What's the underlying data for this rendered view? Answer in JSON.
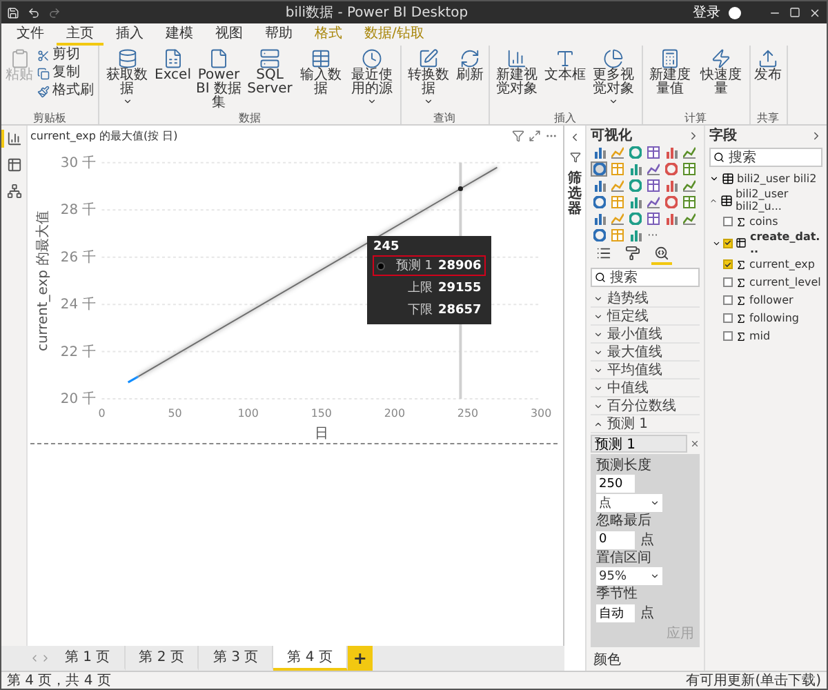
{
  "window": {
    "title": "bili数据 - Power BI Desktop",
    "sign_in": "登录"
  },
  "ribbon_tabs": [
    {
      "label": "文件",
      "selected": false,
      "kind": "normal"
    },
    {
      "label": "主页",
      "selected": true,
      "kind": "normal"
    },
    {
      "label": "插入",
      "selected": false,
      "kind": "normal"
    },
    {
      "label": "建模",
      "selected": false,
      "kind": "normal"
    },
    {
      "label": "视图",
      "selected": false,
      "kind": "normal"
    },
    {
      "label": "帮助",
      "selected": false,
      "kind": "normal"
    },
    {
      "label": "格式",
      "selected": false,
      "kind": "contextual"
    },
    {
      "label": "数据/钻取",
      "selected": false,
      "kind": "contextual"
    }
  ],
  "ribbon_groups": [
    {
      "label": "剪贴板",
      "buttons": [
        {
          "label": "粘贴",
          "kind": "large",
          "disabled": true,
          "dropdown": false
        },
        {
          "label": "剪切",
          "kind": "small",
          "disabled": false,
          "dropdown": false
        },
        {
          "label": "复制",
          "kind": "small",
          "disabled": false,
          "dropdown": false
        },
        {
          "label": "格式刷",
          "kind": "small",
          "disabled": false,
          "dropdown": false
        }
      ]
    },
    {
      "label": "数据",
      "buttons": [
        {
          "label": "获取数据",
          "kind": "large",
          "disabled": false,
          "dropdown": true
        },
        {
          "label": "Excel",
          "kind": "large",
          "disabled": false,
          "dropdown": false
        },
        {
          "label": "Power BI 数据集",
          "kind": "large",
          "disabled": false,
          "dropdown": false
        },
        {
          "label": "SQL Server",
          "kind": "large",
          "disabled": false,
          "dropdown": false
        },
        {
          "label": "输入数据",
          "kind": "large",
          "disabled": false,
          "dropdown": false
        },
        {
          "label": "最近使用的源",
          "kind": "large",
          "disabled": false,
          "dropdown": true
        }
      ]
    },
    {
      "label": "查询",
      "buttons": [
        {
          "label": "转换数据",
          "kind": "large",
          "disabled": false,
          "dropdown": true
        },
        {
          "label": "刷新",
          "kind": "large",
          "disabled": false,
          "dropdown": false
        }
      ]
    },
    {
      "label": "插入",
      "buttons": [
        {
          "label": "新建视觉对象",
          "kind": "large",
          "disabled": false,
          "dropdown": false
        },
        {
          "label": "文本框",
          "kind": "large",
          "disabled": false,
          "dropdown": false
        },
        {
          "label": "更多视觉对象",
          "kind": "large",
          "disabled": false,
          "dropdown": true
        }
      ]
    },
    {
      "label": "计算",
      "buttons": [
        {
          "label": "新建度量值",
          "kind": "large",
          "disabled": false,
          "dropdown": false
        },
        {
          "label": "快速度量",
          "kind": "large",
          "disabled": false,
          "dropdown": false
        }
      ]
    },
    {
      "label": "共享",
      "buttons": [
        {
          "label": "发布",
          "kind": "large",
          "disabled": false,
          "dropdown": false
        }
      ]
    }
  ],
  "views": [
    {
      "selected": true
    },
    {
      "selected": false
    },
    {
      "selected": false
    }
  ],
  "visual": {
    "title": "current_exp 的最大值(按 日)",
    "chart_data": {
      "type": "line",
      "xlabel": "日",
      "ylabel": "current_exp 的最大值",
      "x": [
        18,
        25,
        245,
        270
      ],
      "series": [
        {
          "color": "#118dff",
          "values": [
            20.7,
            20.95,
            null,
            null
          ]
        },
        {
          "color": "#6e6e6e",
          "values": [
            null,
            20.95,
            28.9,
            29.8
          ]
        }
      ],
      "xlim": [
        0,
        300
      ],
      "ylim": [
        20,
        30
      ],
      "xticks": [
        0,
        50,
        100,
        150,
        200,
        250,
        300
      ],
      "yticks": [
        {
          "value": 20,
          "label": "20 千"
        },
        {
          "value": 22,
          "label": "22 千"
        },
        {
          "value": 24,
          "label": "24 千"
        },
        {
          "value": 26,
          "label": "26 千"
        },
        {
          "value": 28,
          "label": "28 千"
        },
        {
          "value": 30,
          "label": "30 千"
        }
      ],
      "grid": true,
      "ref_lines": [
        {
          "axis": "x",
          "value": 245,
          "color": "#cfcfcf"
        }
      ]
    },
    "tooltip": {
      "title": "245",
      "rows": [
        {
          "label": "预测 1",
          "value": "28906",
          "marker": true,
          "highlighted": true
        },
        {
          "label": "上限",
          "value": "29155",
          "marker": false,
          "highlighted": false
        },
        {
          "label": "下限",
          "value": "28657",
          "marker": false,
          "highlighted": false
        }
      ]
    }
  },
  "pages": [
    {
      "label": "第 1 页",
      "selected": false
    },
    {
      "label": "第 2 页",
      "selected": false
    },
    {
      "label": "第 3 页",
      "selected": false
    },
    {
      "label": "第 4 页",
      "selected": true
    }
  ],
  "add_page": "+",
  "filters_pane": {
    "label": "筛选器"
  },
  "visualizations": {
    "title": "可视化",
    "gallery": [
      {
        "selected": false
      },
      {
        "selected": false
      },
      {
        "selected": false
      },
      {
        "selected": false
      },
      {
        "selected": false
      },
      {
        "selected": false
      },
      {
        "selected": true
      },
      {
        "selected": false
      },
      {
        "selected": false
      },
      {
        "selected": false
      },
      {
        "selected": false
      },
      {
        "selected": false
      },
      {
        "selected": false
      },
      {
        "selected": false
      },
      {
        "selected": false
      },
      {
        "selected": false
      },
      {
        "selected": false
      },
      {
        "selected": false
      },
      {
        "selected": false
      },
      {
        "selected": false
      },
      {
        "selected": false
      },
      {
        "selected": false
      },
      {
        "selected": false
      },
      {
        "selected": false
      },
      {
        "selected": false
      },
      {
        "selected": false
      },
      {
        "selected": false
      },
      {
        "selected": false
      },
      {
        "selected": false
      },
      {
        "selected": false
      },
      {
        "selected": false
      },
      {
        "selected": false
      },
      {
        "selected": false
      }
    ],
    "more": "···",
    "pane_tabs": [
      {
        "selected": false
      },
      {
        "selected": false
      },
      {
        "selected": true
      }
    ],
    "search": {
      "placeholder": "搜索"
    },
    "sections": [
      {
        "label": "趋势线",
        "expanded": false
      },
      {
        "label": "恒定线",
        "expanded": false
      },
      {
        "label": "最小值线",
        "expanded": false
      },
      {
        "label": "最大值线",
        "expanded": false
      },
      {
        "label": "平均值线",
        "expanded": false
      },
      {
        "label": "中值线",
        "expanded": false
      },
      {
        "label": "百分位数线",
        "expanded": false
      },
      {
        "label": "预测 1",
        "expanded": true,
        "forecast": {
          "name": "预测 1",
          "length_label": "预测长度",
          "length": "250",
          "length_unit": "点",
          "ignore_label": "忽略最后",
          "ignore": "0",
          "ignore_unit": "点",
          "confidence_label": "置信区间",
          "confidence": "95%",
          "seasonality_label": "季节性",
          "seasonality": "自动",
          "seasonality_unit": "点",
          "apply": "应用",
          "apply_disabled": true
        }
      }
    ],
    "color_section": "颜色"
  },
  "fields": {
    "title": "字段",
    "search": {
      "placeholder": "搜索"
    },
    "tables": [
      {
        "name": "bili2_user bili2",
        "expanded": false
      },
      {
        "name": "bili2_user bili2_u...",
        "expanded": true,
        "children": [
          {
            "name": "coins",
            "checked": false,
            "kind": "measure"
          },
          {
            "name": "create_dat...",
            "checked": true,
            "kind": "hierarchy"
          },
          {
            "name": "current_exp",
            "checked": true,
            "kind": "measure"
          },
          {
            "name": "current_level",
            "checked": false,
            "kind": "measure"
          },
          {
            "name": "follower",
            "checked": false,
            "kind": "measure"
          },
          {
            "name": "following",
            "checked": false,
            "kind": "measure"
          },
          {
            "name": "mid",
            "checked": false,
            "kind": "measure"
          }
        ]
      }
    ]
  },
  "status_bar": {
    "left": "第 4 页，共 4 页",
    "right": "有可用更新(单击下载)"
  }
}
